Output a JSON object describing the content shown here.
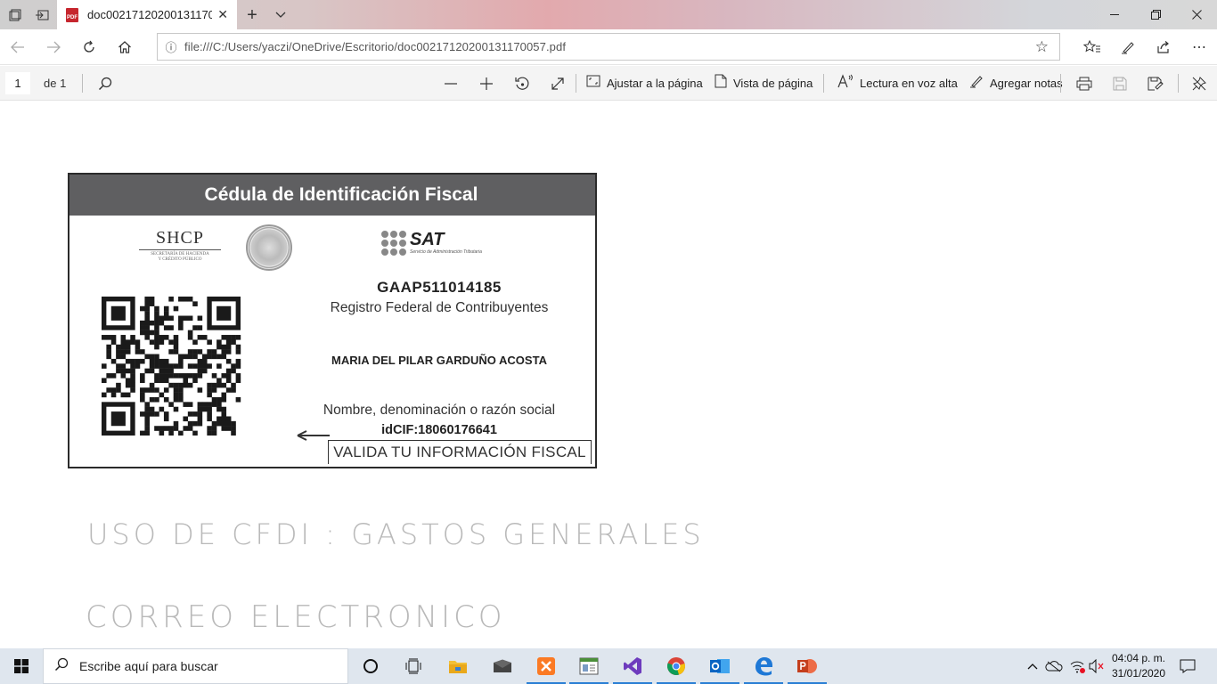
{
  "browser": {
    "tab_title": "doc00217120200131170057.pdf",
    "tab_title_visible": "doc002171202001311700",
    "url": "file:///C:/Users/yaczi/OneDrive/Escritorio/doc00217120200131170057.pdf",
    "new_tab_symbol": "+",
    "close_symbol": "✕"
  },
  "pdf_toolbar": {
    "page_number": "1",
    "page_count": "de 1",
    "fit_label": "Ajustar a la página",
    "page_view_label": "Vista de página",
    "read_aloud_label": "Lectura en voz alta",
    "add_notes_label": "Agregar notas"
  },
  "cedula": {
    "header": "Cédula de Identificación Fiscal",
    "shcp": "SHCP",
    "shcp_sub1": "SECRETARÍA DE HACIENDA",
    "shcp_sub2": "Y CRÉDITO PÚBLICO",
    "sat": "SAT",
    "sat_sub": "Servicio de Administración Tributaria",
    "rfc": "GAAP511014185",
    "rfc_label": "Registro Federal de Contribuyentes",
    "name": "MARIA DEL PILAR GARDUÑO ACOSTA",
    "name_label": "Nombre, denominación o razón social",
    "idcif": "idCIF:18060176641",
    "valida": "VALIDA TU INFORMACIÓN FISCAL"
  },
  "handwriting": {
    "line1": "USO DE CFDI : GASTOS GENERALES",
    "line2": "CORREO ELECTRONICO"
  },
  "taskbar": {
    "search_placeholder": "Escribe aquí para buscar",
    "time": "04:04 p. m.",
    "date": "31/01/2020"
  },
  "colors": {
    "header_gray": "#5f5f61",
    "accent_blue": "#2a7fd4",
    "pdf_red": "#c6262e"
  }
}
